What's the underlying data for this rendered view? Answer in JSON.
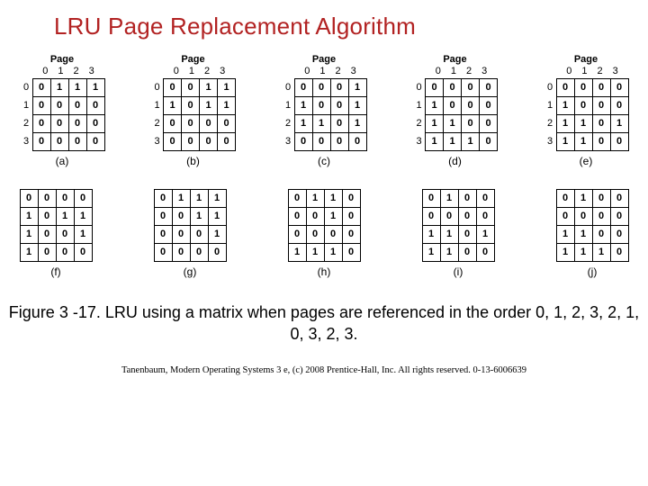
{
  "title": "LRU Page Replacement Algorithm",
  "col_headers": [
    "0",
    "1",
    "2",
    "3"
  ],
  "row_headers": [
    "0",
    "1",
    "2",
    "3"
  ],
  "page_label": "Page",
  "top": [
    {
      "sub": "(a)",
      "m": [
        [
          "0",
          "1",
          "1",
          "1"
        ],
        [
          "0",
          "0",
          "0",
          "0"
        ],
        [
          "0",
          "0",
          "0",
          "0"
        ],
        [
          "0",
          "0",
          "0",
          "0"
        ]
      ]
    },
    {
      "sub": "(b)",
      "m": [
        [
          "0",
          "0",
          "1",
          "1"
        ],
        [
          "1",
          "0",
          "1",
          "1"
        ],
        [
          "0",
          "0",
          "0",
          "0"
        ],
        [
          "0",
          "0",
          "0",
          "0"
        ]
      ]
    },
    {
      "sub": "(c)",
      "m": [
        [
          "0",
          "0",
          "0",
          "1"
        ],
        [
          "1",
          "0",
          "0",
          "1"
        ],
        [
          "1",
          "1",
          "0",
          "1"
        ],
        [
          "0",
          "0",
          "0",
          "0"
        ]
      ]
    },
    {
      "sub": "(d)",
      "m": [
        [
          "0",
          "0",
          "0",
          "0"
        ],
        [
          "1",
          "0",
          "0",
          "0"
        ],
        [
          "1",
          "1",
          "0",
          "0"
        ],
        [
          "1",
          "1",
          "1",
          "0"
        ]
      ]
    },
    {
      "sub": "(e)",
      "m": [
        [
          "0",
          "0",
          "0",
          "0"
        ],
        [
          "1",
          "0",
          "0",
          "0"
        ],
        [
          "1",
          "1",
          "0",
          "1"
        ],
        [
          "1",
          "1",
          "0",
          "0"
        ]
      ]
    }
  ],
  "bottom": [
    {
      "sub": "(f)",
      "m": [
        [
          "0",
          "0",
          "0",
          "0"
        ],
        [
          "1",
          "0",
          "1",
          "1"
        ],
        [
          "1",
          "0",
          "0",
          "1"
        ],
        [
          "1",
          "0",
          "0",
          "0"
        ]
      ]
    },
    {
      "sub": "(g)",
      "m": [
        [
          "0",
          "1",
          "1",
          "1"
        ],
        [
          "0",
          "0",
          "1",
          "1"
        ],
        [
          "0",
          "0",
          "0",
          "1"
        ],
        [
          "0",
          "0",
          "0",
          "0"
        ]
      ]
    },
    {
      "sub": "(h)",
      "m": [
        [
          "0",
          "1",
          "1",
          "0"
        ],
        [
          "0",
          "0",
          "1",
          "0"
        ],
        [
          "0",
          "0",
          "0",
          "0"
        ],
        [
          "1",
          "1",
          "1",
          "0"
        ]
      ]
    },
    {
      "sub": "(i)",
      "m": [
        [
          "0",
          "1",
          "0",
          "0"
        ],
        [
          "0",
          "0",
          "0",
          "0"
        ],
        [
          "1",
          "1",
          "0",
          "1"
        ],
        [
          "1",
          "1",
          "0",
          "0"
        ]
      ]
    },
    {
      "sub": "(j)",
      "m": [
        [
          "0",
          "1",
          "0",
          "0"
        ],
        [
          "0",
          "0",
          "0",
          "0"
        ],
        [
          "1",
          "1",
          "0",
          "0"
        ],
        [
          "1",
          "1",
          "1",
          "0"
        ]
      ]
    }
  ],
  "caption": "Figure 3 -17. LRU using a matrix when pages are referenced in the order 0, 1, 2, 3, 2, 1, 0, 3, 2, 3.",
  "footer": "Tanenbaum, Modern Operating Systems 3 e, (c) 2008 Prentice-Hall, Inc. All rights reserved. 0-13-6006639"
}
